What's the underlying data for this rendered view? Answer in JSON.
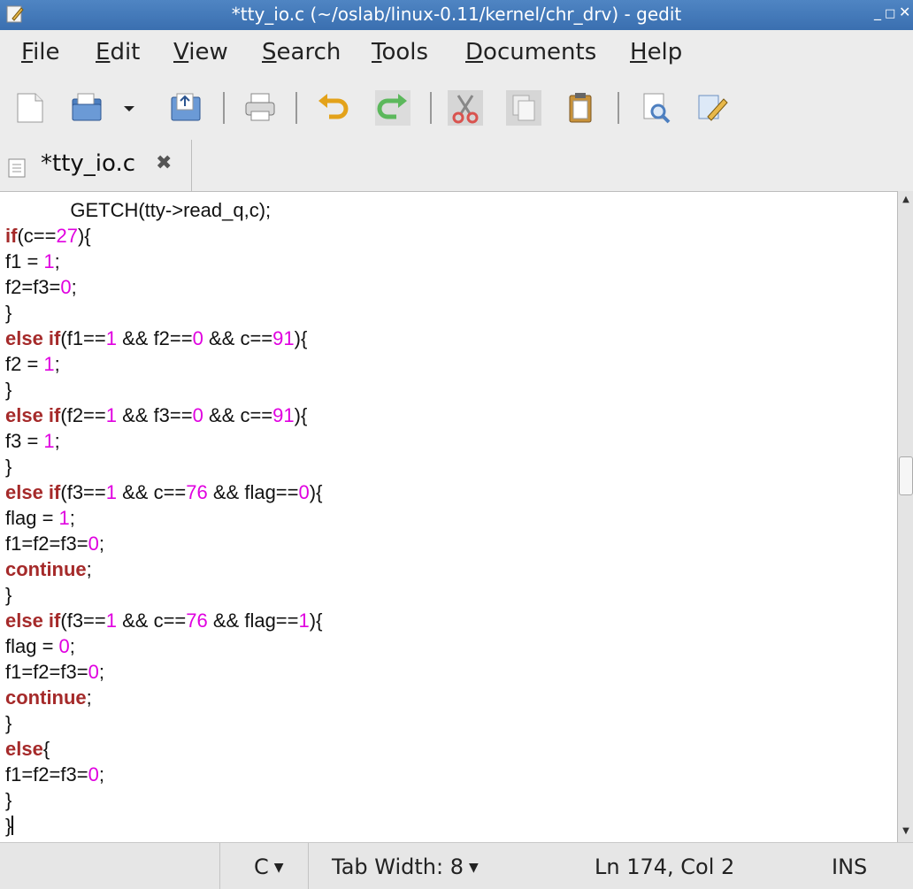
{
  "window": {
    "title": "*tty_io.c (~/oslab/linux-0.11/kernel/chr_drv) - gedit",
    "minimize": "_",
    "maximize": "□",
    "close": "✕"
  },
  "menu": {
    "file": {
      "mnemonic": "F",
      "rest": "ile"
    },
    "edit": {
      "mnemonic": "E",
      "rest": "dit"
    },
    "view": {
      "mnemonic": "V",
      "rest": "iew"
    },
    "search": {
      "mnemonic": "S",
      "rest": "earch"
    },
    "tools": {
      "mnemonic": "T",
      "rest": "ools"
    },
    "documents": {
      "mnemonic": "D",
      "rest": "ocuments"
    },
    "help": {
      "mnemonic": "H",
      "rest": "elp"
    }
  },
  "toolbar": {
    "icons": [
      "new-document-icon",
      "open-icon",
      "open-dropdown-icon",
      "save-icon",
      "print-icon",
      "undo-icon",
      "redo-icon",
      "cut-icon",
      "copy-icon",
      "paste-icon",
      "find-icon",
      "replace-icon"
    ]
  },
  "tab": {
    "label": "*tty_io.c",
    "close": "✖"
  },
  "editor": {
    "lines": [
      [
        {
          "t": "            GETCH(tty->read_q,c);",
          "c": "plain"
        }
      ],
      [
        {
          "t": "if",
          "c": "kw"
        },
        {
          "t": "(c==",
          "c": "plain"
        },
        {
          "t": "27",
          "c": "num"
        },
        {
          "t": "){",
          "c": "plain"
        }
      ],
      [
        {
          "t": "f1 = ",
          "c": "plain"
        },
        {
          "t": "1",
          "c": "num"
        },
        {
          "t": ";",
          "c": "plain"
        }
      ],
      [
        {
          "t": "f2=f3=",
          "c": "plain"
        },
        {
          "t": "0",
          "c": "num"
        },
        {
          "t": ";",
          "c": "plain"
        }
      ],
      [
        {
          "t": "}",
          "c": "plain"
        }
      ],
      [
        {
          "t": "else if",
          "c": "kw"
        },
        {
          "t": "(f1==",
          "c": "plain"
        },
        {
          "t": "1",
          "c": "num"
        },
        {
          "t": " && f2==",
          "c": "plain"
        },
        {
          "t": "0",
          "c": "num"
        },
        {
          "t": " && c==",
          "c": "plain"
        },
        {
          "t": "91",
          "c": "num"
        },
        {
          "t": "){",
          "c": "plain"
        }
      ],
      [
        {
          "t": "f2 = ",
          "c": "plain"
        },
        {
          "t": "1",
          "c": "num"
        },
        {
          "t": ";",
          "c": "plain"
        }
      ],
      [
        {
          "t": "}",
          "c": "plain"
        }
      ],
      [
        {
          "t": "else if",
          "c": "kw"
        },
        {
          "t": "(f2==",
          "c": "plain"
        },
        {
          "t": "1",
          "c": "num"
        },
        {
          "t": " && f3==",
          "c": "plain"
        },
        {
          "t": "0",
          "c": "num"
        },
        {
          "t": " && c==",
          "c": "plain"
        },
        {
          "t": "91",
          "c": "num"
        },
        {
          "t": "){",
          "c": "plain"
        }
      ],
      [
        {
          "t": "f3 = ",
          "c": "plain"
        },
        {
          "t": "1",
          "c": "num"
        },
        {
          "t": ";",
          "c": "plain"
        }
      ],
      [
        {
          "t": "}",
          "c": "plain"
        }
      ],
      [
        {
          "t": "else if",
          "c": "kw"
        },
        {
          "t": "(f3==",
          "c": "plain"
        },
        {
          "t": "1",
          "c": "num"
        },
        {
          "t": " && c==",
          "c": "plain"
        },
        {
          "t": "76",
          "c": "num"
        },
        {
          "t": " && flag==",
          "c": "plain"
        },
        {
          "t": "0",
          "c": "num"
        },
        {
          "t": "){",
          "c": "plain"
        }
      ],
      [
        {
          "t": "flag = ",
          "c": "plain"
        },
        {
          "t": "1",
          "c": "num"
        },
        {
          "t": ";",
          "c": "plain"
        }
      ],
      [
        {
          "t": "f1=f2=f3=",
          "c": "plain"
        },
        {
          "t": "0",
          "c": "num"
        },
        {
          "t": ";",
          "c": "plain"
        }
      ],
      [
        {
          "t": "continue",
          "c": "kw"
        },
        {
          "t": ";",
          "c": "plain"
        }
      ],
      [
        {
          "t": "}",
          "c": "plain"
        }
      ],
      [
        {
          "t": "else if",
          "c": "kw"
        },
        {
          "t": "(f3==",
          "c": "plain"
        },
        {
          "t": "1",
          "c": "num"
        },
        {
          "t": " && c==",
          "c": "plain"
        },
        {
          "t": "76",
          "c": "num"
        },
        {
          "t": " && flag==",
          "c": "plain"
        },
        {
          "t": "1",
          "c": "num"
        },
        {
          "t": "){",
          "c": "plain"
        }
      ],
      [
        {
          "t": "flag = ",
          "c": "plain"
        },
        {
          "t": "0",
          "c": "num"
        },
        {
          "t": ";",
          "c": "plain"
        }
      ],
      [
        {
          "t": "f1=f2=f3=",
          "c": "plain"
        },
        {
          "t": "0",
          "c": "num"
        },
        {
          "t": ";",
          "c": "plain"
        }
      ],
      [
        {
          "t": "continue",
          "c": "kw"
        },
        {
          "t": ";",
          "c": "plain"
        }
      ],
      [
        {
          "t": "}",
          "c": "plain"
        }
      ],
      [
        {
          "t": "else",
          "c": "kw"
        },
        {
          "t": "{",
          "c": "plain"
        }
      ],
      [
        {
          "t": "f1=f2=f3=",
          "c": "plain"
        },
        {
          "t": "0",
          "c": "num"
        },
        {
          "t": ";",
          "c": "plain"
        }
      ],
      [
        {
          "t": "}",
          "c": "plain"
        }
      ],
      [
        {
          "t": "}",
          "c": "plain"
        }
      ]
    ]
  },
  "statusbar": {
    "language": "C",
    "tab_width": "Tab Width:  8",
    "position": "Ln 174, Col 2",
    "mode": "INS"
  },
  "colors": {
    "keyword": "#a52a2a",
    "number": "#e000e0",
    "titlebar": "#3a6fb0"
  }
}
